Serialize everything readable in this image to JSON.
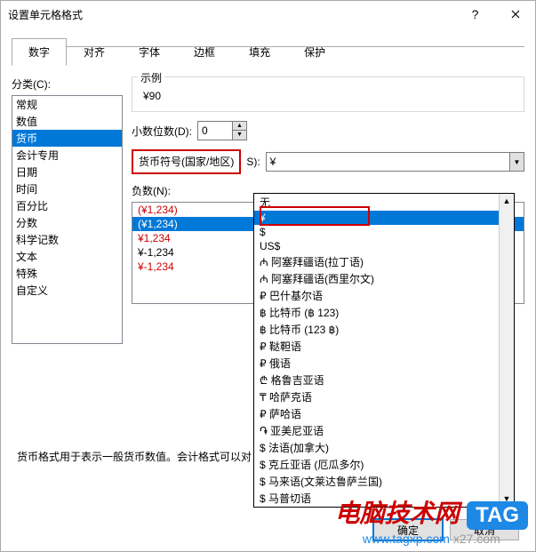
{
  "title": "设置单元格格式",
  "tabs": [
    "数字",
    "对齐",
    "字体",
    "边框",
    "填充",
    "保护"
  ],
  "active_tab": 0,
  "category_label": "分类(C):",
  "categories": [
    "常规",
    "数值",
    "货币",
    "会计专用",
    "日期",
    "时间",
    "百分比",
    "分数",
    "科学记数",
    "文本",
    "特殊",
    "自定义"
  ],
  "selected_category": 2,
  "sample": {
    "legend": "示例",
    "value": "¥90"
  },
  "decimal": {
    "label": "小数位数(D):",
    "value": "0"
  },
  "symbol": {
    "label": "货币符号(国家/地区)",
    "suffix": "S):",
    "selected": "¥"
  },
  "neg_label": "负数(N):",
  "neg_items": [
    {
      "text": "(¥1,234)",
      "cls": "red"
    },
    {
      "text": "(¥1,234)",
      "cls": "selected"
    },
    {
      "text": "¥1,234",
      "cls": "red"
    },
    {
      "text": "¥-1,234",
      "cls": ""
    },
    {
      "text": "¥-1,234",
      "cls": "red"
    }
  ],
  "dropdown": {
    "selected_index": 1,
    "items": [
      "无",
      "¥",
      "$",
      "US$",
      "₼ 阿塞拜疆语(拉丁语)",
      "₼ 阿塞拜疆语(西里尔文)",
      "₽ 巴什基尔语",
      "฿ 比特币 (฿ 123)",
      "฿ 比特币 (123 ฿)",
      "₽ 鞑靼语",
      "₽ 俄语",
      "₾ 格鲁吉亚语",
      "₸ 哈萨克语",
      "₽ 萨哈语",
      "֏ 亚美尼亚语",
      "$ 法语(加拿大)",
      "$ 克丘亚语 (厄瓜多尔)",
      "$ 马来语(文莱达鲁萨兰国)",
      "$ 马普切语"
    ]
  },
  "description": "货币格式用于表示一般货币数值。会计格式可以对",
  "buttons": {
    "ok": "确定",
    "cancel": "取消"
  },
  "watermark": {
    "text1": "电脑技术网",
    "tag": "TAG",
    "url": "www.tagxp.com",
    "suffix": "x27.com"
  }
}
